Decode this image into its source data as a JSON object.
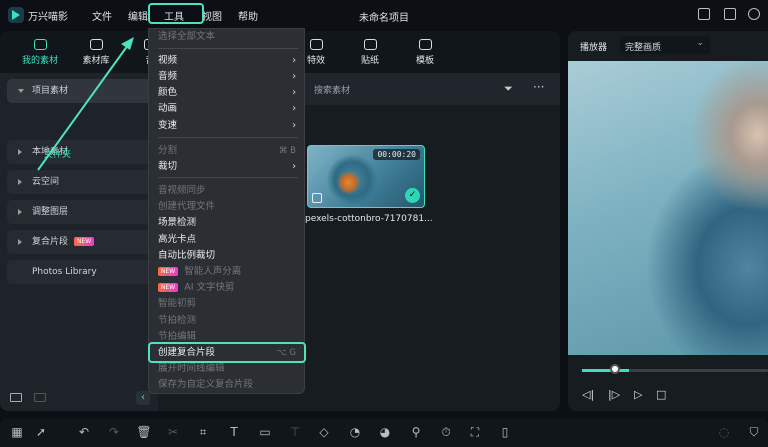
{
  "app": {
    "name": "万兴喵影",
    "document_title": "未命名项目",
    "accent": "#3fe0c0"
  },
  "menubar": [
    "文件",
    "编辑",
    "工具",
    "视图",
    "帮助"
  ],
  "tabs": [
    {
      "label": "我的素材",
      "active": true
    },
    {
      "label": "素材库"
    },
    {
      "label": "音"
    },
    {
      "label": "特效"
    },
    {
      "label": "贴纸"
    },
    {
      "label": "模板"
    }
  ],
  "sidebar": {
    "items": [
      {
        "label": "项目素材",
        "open": true
      },
      {
        "label": "本地素材"
      },
      {
        "label": "云空间"
      },
      {
        "label": "调整图层"
      },
      {
        "label": "复合片段",
        "badge": "NEW"
      },
      {
        "label": "Photos Library"
      }
    ],
    "folder": "文件夹"
  },
  "search": {
    "placeholder": "搜索素材"
  },
  "media": {
    "duration": "00:00:20",
    "name": "pexels-cottonbro-7170781..."
  },
  "tools_menu": {
    "items": [
      {
        "label": "选择全部文本",
        "disabled": true
      },
      {
        "label": "视频",
        "submenu": true
      },
      {
        "label": "音频",
        "submenu": true
      },
      {
        "label": "颜色",
        "submenu": true
      },
      {
        "label": "动画",
        "submenu": true
      },
      {
        "label": "变速",
        "submenu": true
      },
      {
        "label": "分割",
        "disabled": true,
        "shortcut": "⌘ B"
      },
      {
        "label": "裁切",
        "submenu": true
      },
      {
        "label": "音视频同步",
        "disabled": true
      },
      {
        "label": "创建代理文件",
        "disabled": true
      },
      {
        "label": "场景检测"
      },
      {
        "label": "高光卡点"
      },
      {
        "label": "自动比例裁切"
      },
      {
        "label": "智能人声分离",
        "disabled": true,
        "badge": "NEW"
      },
      {
        "label": "AI 文字快剪",
        "disabled": true,
        "badge": "NEW"
      },
      {
        "label": "智能初剪",
        "disabled": true
      },
      {
        "label": "节拍检测",
        "disabled": true
      },
      {
        "label": "节拍编辑",
        "disabled": true
      },
      {
        "label": "创建复合片段",
        "shortcut": "⌥ G",
        "highlighted": true
      },
      {
        "label": "展开时间线编辑",
        "disabled": true
      },
      {
        "label": "保存为自定义复合片段",
        "disabled": true
      }
    ]
  },
  "player": {
    "label": "播放器",
    "quality": "完整画质",
    "progress_percent": 25
  },
  "icons": {
    "submenu": "›",
    "check": "✓"
  }
}
